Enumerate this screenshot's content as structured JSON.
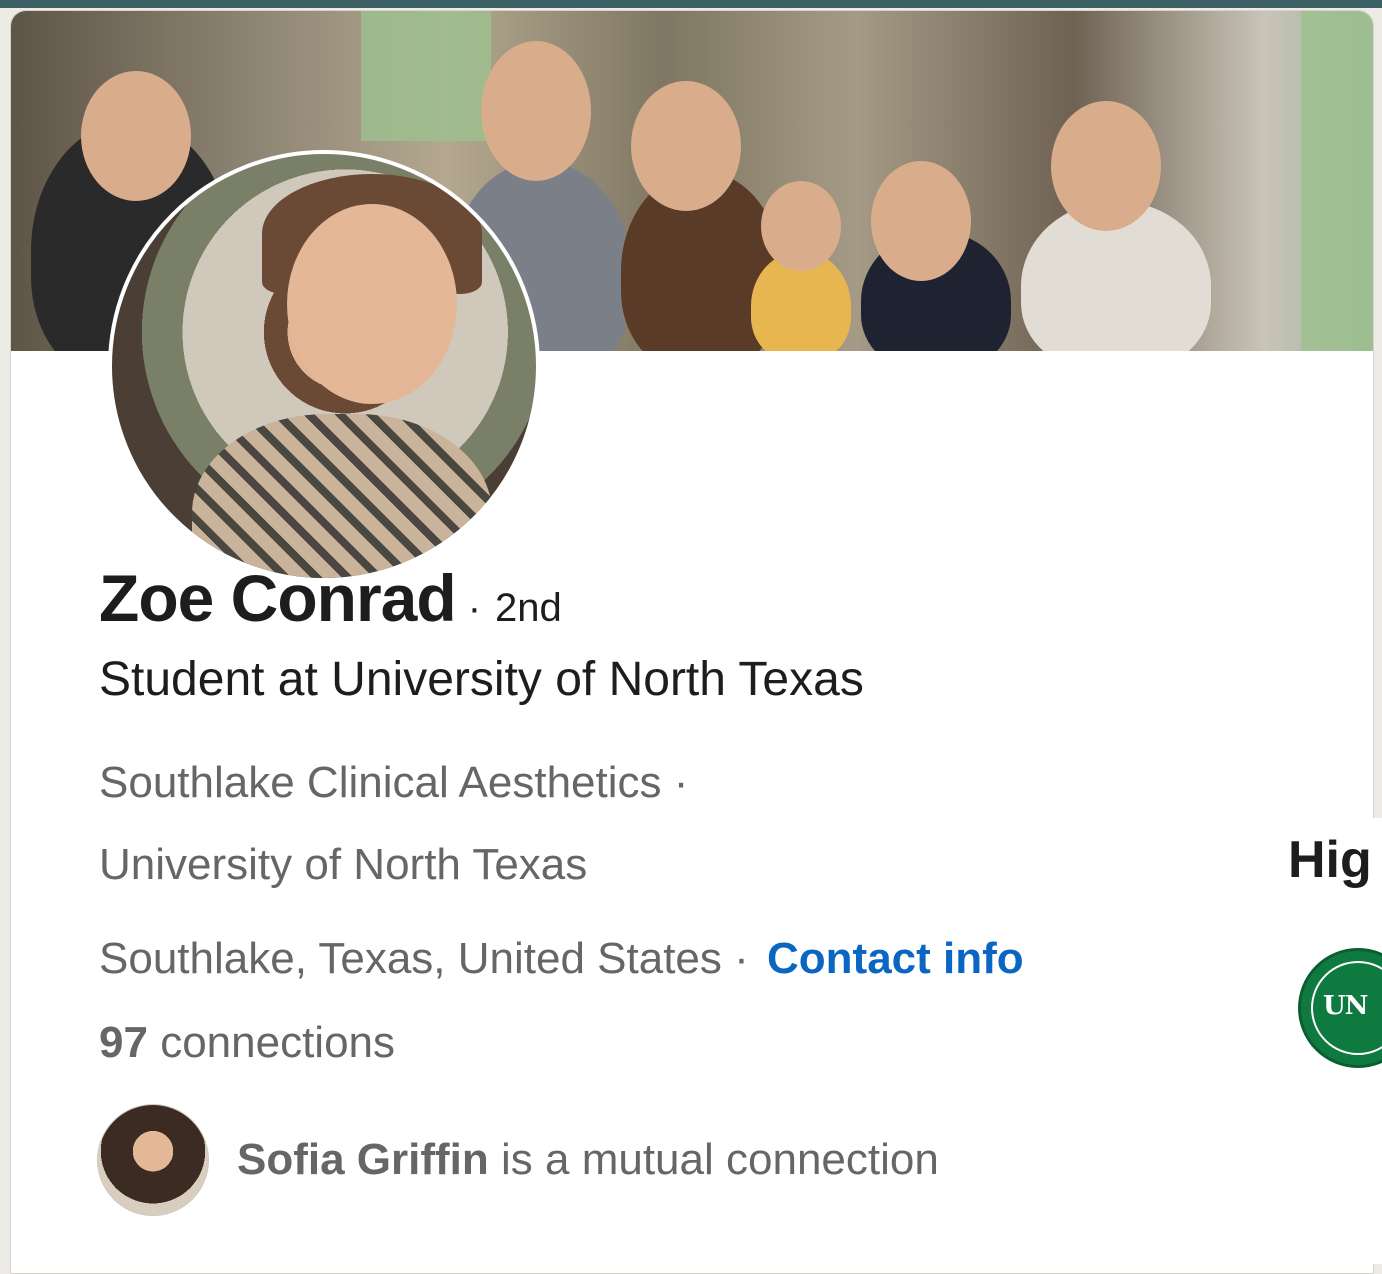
{
  "profile": {
    "name": "Zoe Conrad",
    "degree_separator": "·",
    "degree": "2nd",
    "headline": "Student at University of North Texas",
    "company_line1": "Southlake Clinical Aesthetics ·",
    "company_line2": "University of North Texas",
    "location": "Southlake, Texas, United States ·",
    "contact_label": "Contact info",
    "connections_count": "97",
    "connections_label": "connections",
    "mutual_name": "Sofia Griffin",
    "mutual_suffix": "is a mutual connection"
  },
  "right_panel": {
    "title": "Hig",
    "logo_text": "UN"
  },
  "colors": {
    "link": "#0a66c2",
    "secondary_text": "#666666",
    "primary_text": "#1d1d1d",
    "unt_green": "#0f7a3f"
  },
  "icons": {
    "cover": "cover-photo",
    "avatar": "profile-photo",
    "mutual_avatar": "mutual-connection-avatar",
    "school_logo": "university-logo"
  }
}
